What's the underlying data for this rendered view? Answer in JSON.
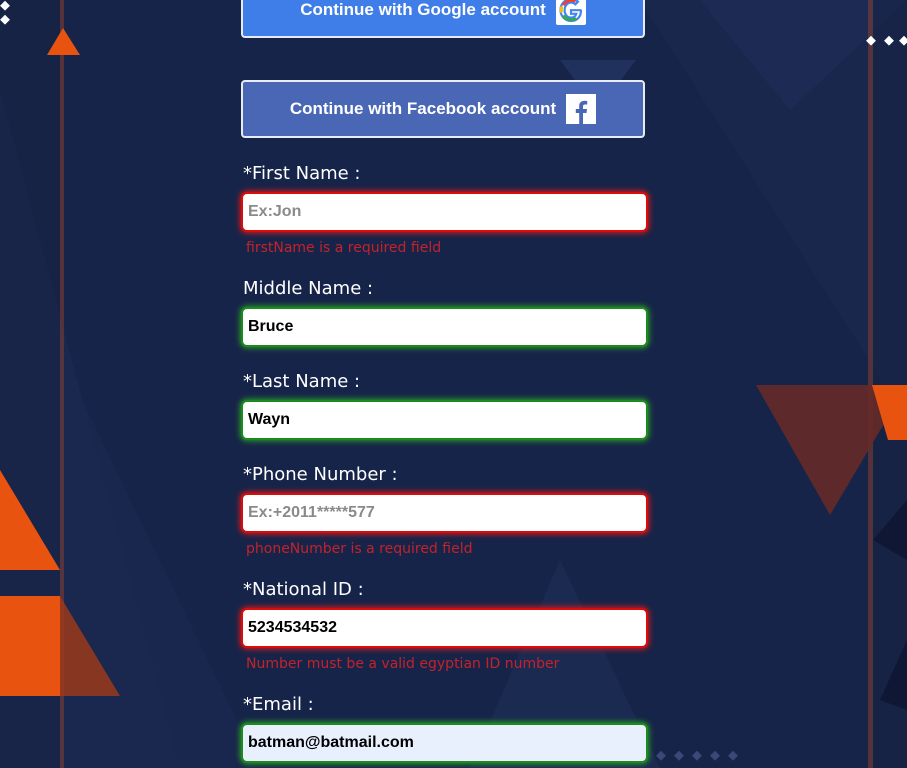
{
  "social": {
    "google_label": "Continue with Google account",
    "facebook_label": "Continue with Facebook account"
  },
  "form": {
    "first_name": {
      "label": "*First Name :",
      "placeholder": "Ex:Jon",
      "value": "",
      "error": "firstName is a required field"
    },
    "middle_name": {
      "label": "Middle Name :",
      "value": "Bruce"
    },
    "last_name": {
      "label": "*Last Name :",
      "value": "Wayn"
    },
    "phone": {
      "label": "*Phone Number :",
      "placeholder": "Ex:+2011*****577",
      "value": "",
      "error": "phoneNumber is a required field"
    },
    "national_id": {
      "label": "*National ID :",
      "value": "5234534532",
      "error": "Number must be a valid egyptian ID number"
    },
    "email": {
      "label": "*Email :",
      "value": "batman@batmail.com"
    }
  },
  "colors": {
    "background": "#172449",
    "accent_orange": "#e8540f",
    "google_button": "#3f7ee8",
    "facebook_button": "#4a67b5",
    "error": "#d90b0b",
    "valid": "#1d8a1d"
  }
}
